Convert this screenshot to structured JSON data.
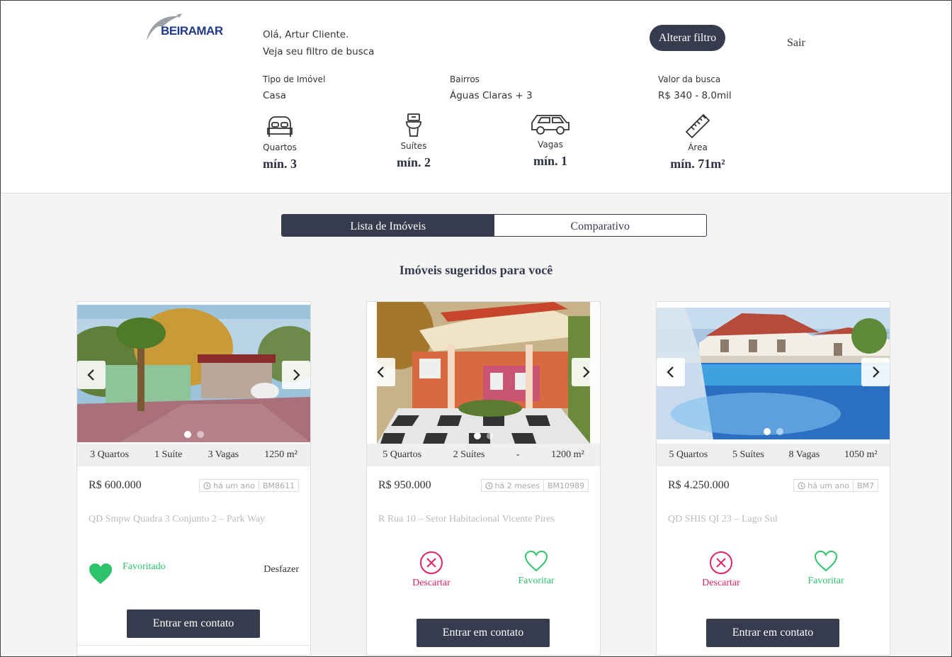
{
  "header": {
    "logo_text": "BEIRAMAR",
    "greeting": "Olá, Artur Cliente.",
    "subtitle": "Veja seu filtro de busca",
    "alter_filter_label": "Alterar filtro",
    "logout_label": "Sair"
  },
  "filter": {
    "type": {
      "label": "Tipo de Imóvel",
      "value": "Casa"
    },
    "neighborhoods": {
      "label": "Bairros",
      "value": "Águas Claras + 3"
    },
    "price": {
      "label": "Valor da busca",
      "value": "R$ 340 - 8.0mil"
    },
    "features": [
      {
        "label": "Quartos",
        "value": "mín. 3",
        "icon": "bed-icon"
      },
      {
        "label": "Suítes",
        "value": "mín. 2",
        "icon": "toilet-icon"
      },
      {
        "label": "Vagas",
        "value": "mín. 1",
        "icon": "car-icon"
      },
      {
        "label": "Área",
        "value": "mín. 71m²",
        "icon": "ruler-icon"
      }
    ]
  },
  "tabs": [
    {
      "label": "Lista de Imóveis",
      "active": true
    },
    {
      "label": "Comparativo",
      "active": false
    }
  ],
  "section_title": "Imóveis sugeridos para você",
  "cards": [
    {
      "specs": [
        "3 Quartos",
        "1 Suíte",
        "3 Vagas",
        "1250 m²"
      ],
      "price": "R$ 600.000",
      "age": "há um ano",
      "code": "BM8611",
      "address": "QD Smpw Quadra 3 Conjunto 2 – Park Way",
      "state": "favorited",
      "favorited_label": "Favoritado",
      "undo_label": "Desfazer",
      "contact_label": "Entrar em contato"
    },
    {
      "specs": [
        "5 Quartos",
        "2 Suítes",
        "-",
        "1200 m²"
      ],
      "price": "R$ 950.000",
      "age": "há 2 meses",
      "code": "BM10989",
      "address": "R Rua 10 – Setor Habitacional Vicente Pires",
      "state": "open",
      "discard_label": "Descartar",
      "favorite_label": "Favoritar",
      "contact_label": "Entrar em contato"
    },
    {
      "specs": [
        "5 Quartos",
        "5 Suítes",
        "8 Vagas",
        "1050 m²"
      ],
      "price": "R$ 4.250.000",
      "age": "há um ano",
      "code": "BM7",
      "address": "QD SHIS QI 23 – Lago Sul",
      "state": "open",
      "discard_label": "Descartar",
      "favorite_label": "Favoritar",
      "contact_label": "Entrar em contato"
    }
  ],
  "colors": {
    "primary": "#363b4e",
    "favorite": "#2ec36a",
    "discard": "#e0245e",
    "brand": "#1f3b87"
  }
}
